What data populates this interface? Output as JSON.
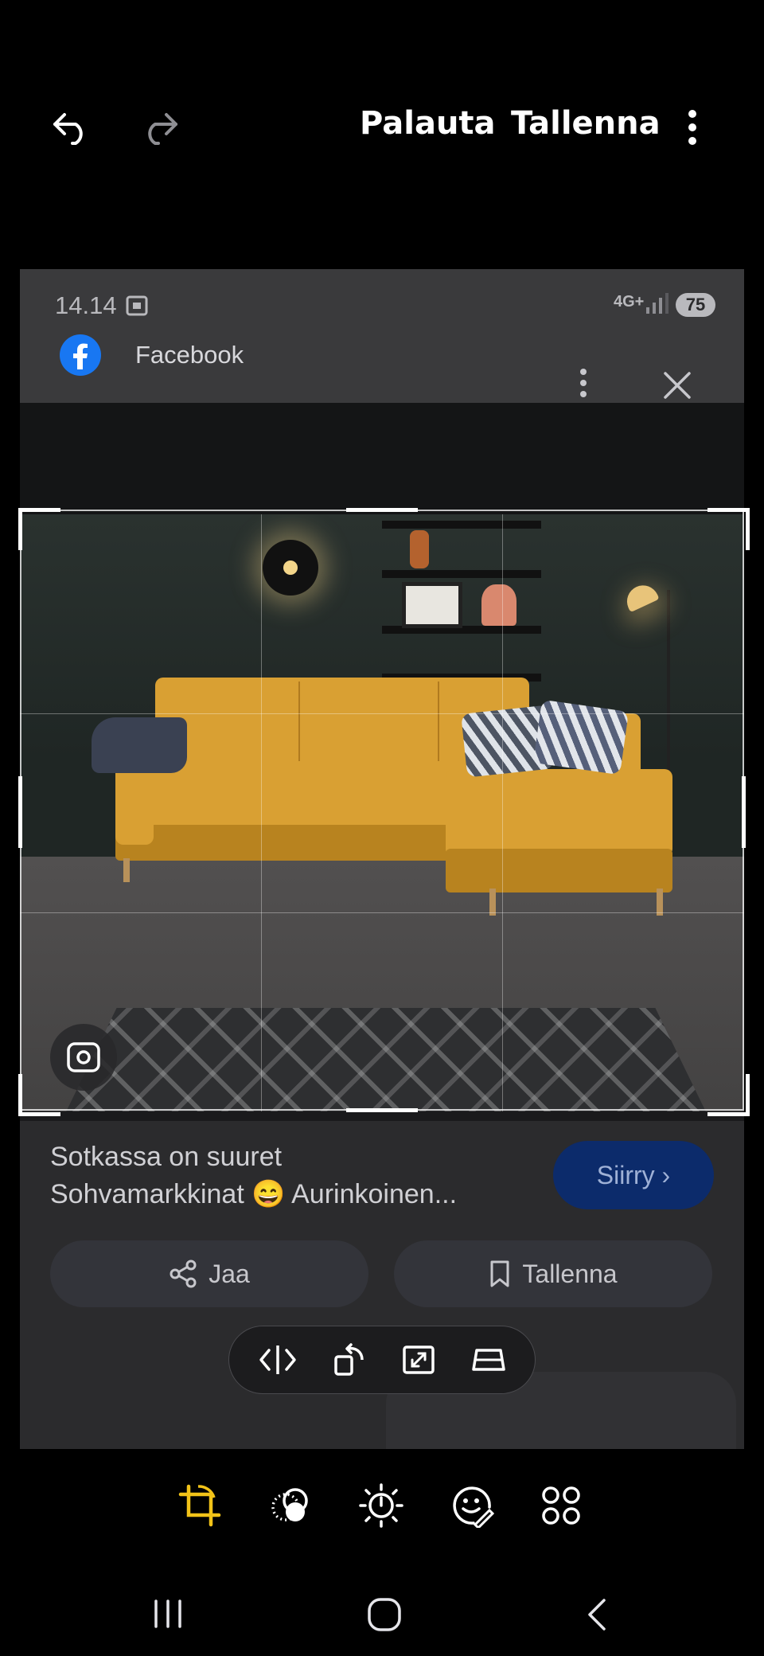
{
  "header": {
    "undo_icon": "undo-arrow-icon",
    "redo_icon": "redo-arrow-icon",
    "revert_label": "Palauta",
    "save_label": "Tallenna",
    "more_icon": "more-vertical-icon"
  },
  "screenshot": {
    "status_bar": {
      "time": "14.14",
      "network": "4G+",
      "battery": "75"
    },
    "app_bar": {
      "title": "Facebook"
    },
    "post": {
      "caption_line1": "Sotkassa on suuret",
      "caption_line2": "Sohvamarkkinat 😄 Aurinkoinen...",
      "go_button": "Siirry ›",
      "share_label": "Jaa",
      "save_label": "Tallenna"
    }
  },
  "float_toolbar": [
    "flip-icon",
    "rotate-icon",
    "aspect-ratio-icon",
    "perspective-icon"
  ],
  "bottom_tools": [
    "crop-rotate-icon",
    "filters-icon",
    "brightness-icon",
    "stickers-icon",
    "more-tools-icon"
  ],
  "colors": {
    "accent": "#f2c318",
    "go_button_bg": "#0c2b6b"
  }
}
